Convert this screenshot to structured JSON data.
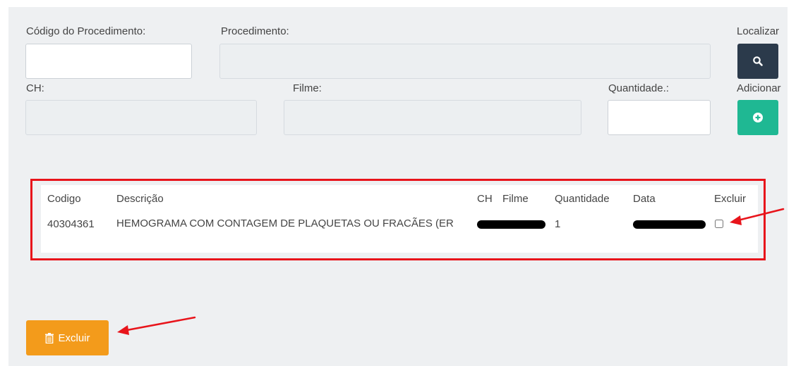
{
  "form": {
    "codigo_label": "Código do Procedimento:",
    "codigo_value": "",
    "procedimento_label": "Procedimento:",
    "procedimento_value": "",
    "localizar_label": "Localizar",
    "ch_label": "CH:",
    "ch_value": "",
    "filme_label": "Filme:",
    "filme_value": "",
    "quantidade_label": "Quantidade.:",
    "quantidade_value": "",
    "adicionar_label": "Adicionar",
    "search_icon": "search-icon",
    "add_icon": "plus-circle-icon"
  },
  "table": {
    "headers": {
      "codigo": "Codigo",
      "descricao": "Descrição",
      "ch": "CH",
      "filme": "Filme",
      "quantidade": "Quantidade",
      "data": "Data",
      "excluir": "Excluir"
    },
    "rows": [
      {
        "codigo": "40304361",
        "descricao": "HEMOGRAMA COM CONTAGEM DE PLAQUETAS OU FRACÃES (ER",
        "quantidade": "1",
        "excluir_checked": false
      }
    ]
  },
  "actions": {
    "excluir_label": "Excluir",
    "excluir_icon": "trash-icon"
  },
  "colors": {
    "search_button": "#2b3a4b",
    "add_button": "#1fb893",
    "excluir_button": "#f39b1b",
    "annotation_red": "#e8141b"
  }
}
